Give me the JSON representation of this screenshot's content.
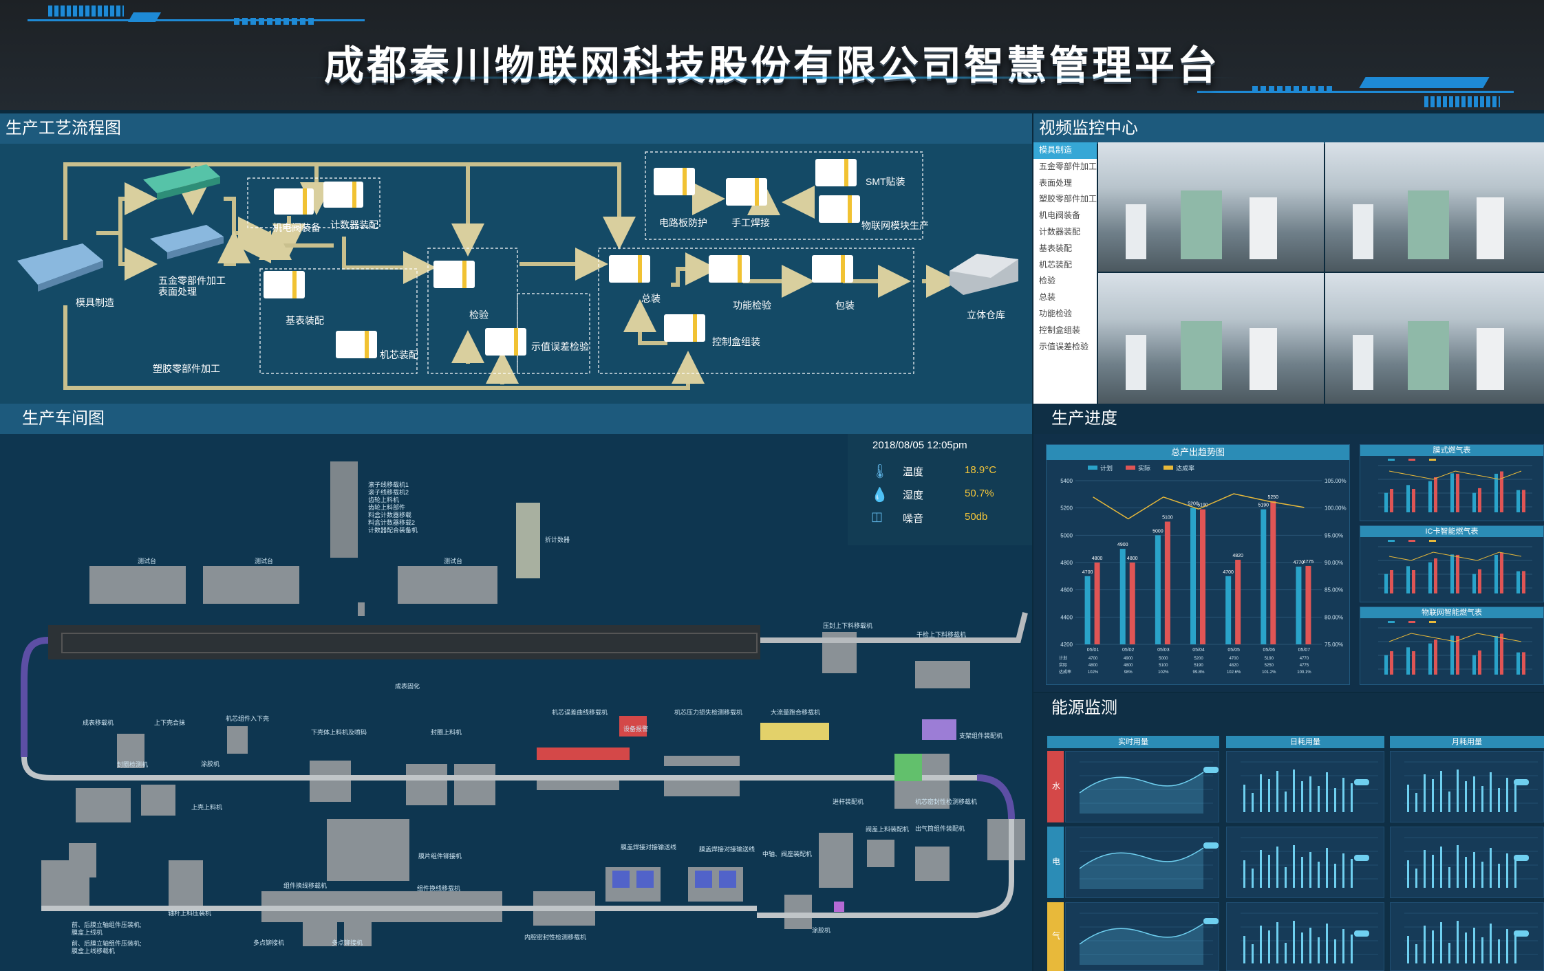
{
  "title": "成都秦川物联网科技股份有限公司智慧管理平台",
  "panels": {
    "process_flow": "生产工艺流程图",
    "video": "视频监控中心",
    "workshop": "生产车间图",
    "progress": "生产进度",
    "energy": "能源监测"
  },
  "flow_nodes": {
    "mold": "模具制造",
    "hardware": "五金零部件加工",
    "surface": "表面处理",
    "plastic": "塑胶零部件加工",
    "valve": "机电阀装备",
    "counter": "计数器装配",
    "base": "基表装配",
    "core": "机芯装配",
    "inspect": "检验",
    "error": "示值误差检验",
    "pcb": "电路板防护",
    "weld": "手工焊接",
    "smt": "SMT贴装",
    "iot": "物联网模块生产",
    "assembly": "总装",
    "function": "功能检验",
    "package": "包装",
    "control": "控制盒组装",
    "warehouse": "立体仓库"
  },
  "video_menu": [
    "模具制造",
    "五金零部件加工",
    "表面处理",
    "塑胶零部件加工",
    "机电阀装备",
    "计数器装配",
    "基表装配",
    "机芯装配",
    "检验",
    "总装",
    "功能检验",
    "控制盒组装",
    "示值误差检验"
  ],
  "env": {
    "datetime": "2018/08/05   12:05pm",
    "temp_label": "温度",
    "temp": "18.9°C",
    "hum_label": "湿度",
    "hum": "50.7%",
    "noise_label": "噪音",
    "noise": "50db"
  },
  "workshop_labels": {
    "test1": "测试台",
    "test2": "测试台",
    "test3": "测试台",
    "feeder": "滚子线移载机1\n滚子线移载机2\n齿轮上料机\n齿轮上料部件\n料盒计数器移载\n料盒计数器移载2\n计数器配合装备机",
    "folder": "折计数器",
    "cure": "成表固化",
    "press": "压封上下料移载机",
    "updown": "干检上下料移载机",
    "line1": "成表移载机",
    "line2": "上下壳合抹",
    "line3": "机芯组件入下壳",
    "line4": "下壳体上料机及喷码",
    "line5": "封圈上料机",
    "line6": "机芯误差曲线移载机",
    "line7": "机芯压力损失检测移载机",
    "line8": "大流量跑合移载机",
    "line9": "支架组件装配机",
    "alarm": "设备报警",
    "seal": "封圈检测机",
    "paint": "涂胶机",
    "upshell": "上壳上料机",
    "pump": "进杆装配机",
    "airtest": "机芯密封性检测移载机",
    "gear": "膜片组件铆接机",
    "gear2": "组件换线移载机",
    "gear3": "组件换线移载机",
    "weld1": "膜盖焊接对接输送线",
    "weld2": "膜盖焊接对接输送线",
    "valve1": "中轴、阀座装配机",
    "valve2": "阀盖上料装配机",
    "valve3": "出气筒组件装配机",
    "rivet": "多点铆接机",
    "rivet2": "多点铆接机",
    "inner": "内腔密封性检测移载机",
    "glue": "涂胶机",
    "shaft": "轴杆上料压装机",
    "left1": "前、后膜立轴组件压装机;\n膜盒上线机",
    "left2": "前、后膜立轴组件压装机;\n膜盒上线移载机"
  },
  "chart_main": {
    "title": "总产出趋势图",
    "legend": [
      "计划",
      "实际",
      "达成率"
    ]
  },
  "chart_small": {
    "t1": "膜式燃气表",
    "t2": "IC卡智能燃气表",
    "t3": "物联网智能燃气表"
  },
  "energy": {
    "col1": "实时用量",
    "col2": "日耗用量",
    "col3": "月耗用量",
    "row1": "水",
    "row2": "电",
    "row3": "气"
  },
  "colors": {
    "plan": "#2aa3c9",
    "actual": "#e05555",
    "rate": "#e8b93a"
  },
  "chart_data": {
    "type": "bar",
    "title": "总产出趋势图",
    "categories": [
      "05/01",
      "05/02",
      "05/03",
      "05/04",
      "05/05",
      "05/06",
      "05/07"
    ],
    "series": [
      {
        "name": "计划",
        "values": [
          4700,
          4900,
          5000,
          5200,
          4700,
          5190,
          4770
        ]
      },
      {
        "name": "实际",
        "values": [
          4800,
          4800,
          5100,
          5190,
          4820,
          5250,
          4775
        ]
      },
      {
        "name": "达成率",
        "values": [
          102,
          98,
          102,
          99.8,
          102.6,
          101.2,
          100.1
        ]
      }
    ],
    "ylim": [
      4200,
      5400
    ],
    "yticks": [
      4200,
      4400,
      4600,
      4800,
      5000,
      5200,
      5400
    ],
    "y2ticks": [
      "75.00%",
      "80.00%",
      "85.00%",
      "90.00%",
      "95.00%",
      "100.00%",
      "105.00%"
    ],
    "value_labels": [
      [
        "4700",
        "4800"
      ],
      [
        "4900",
        "4800"
      ],
      [
        "5000",
        "5100"
      ],
      [
        "5200",
        "5190"
      ],
      [
        "4700",
        "4820"
      ],
      [
        "5190",
        "5250"
      ],
      [
        "4770",
        "4775"
      ]
    ],
    "table": [
      [
        "4700",
        "4900",
        "5000",
        "5200",
        "4700",
        "5190",
        "4770"
      ],
      [
        "4800",
        "4800",
        "5100",
        "5190",
        "4820",
        "5250",
        "4775"
      ],
      [
        "102%",
        "98%",
        "102%",
        "99.8%",
        "102.6%",
        "101.2%",
        "100.1%"
      ]
    ]
  }
}
